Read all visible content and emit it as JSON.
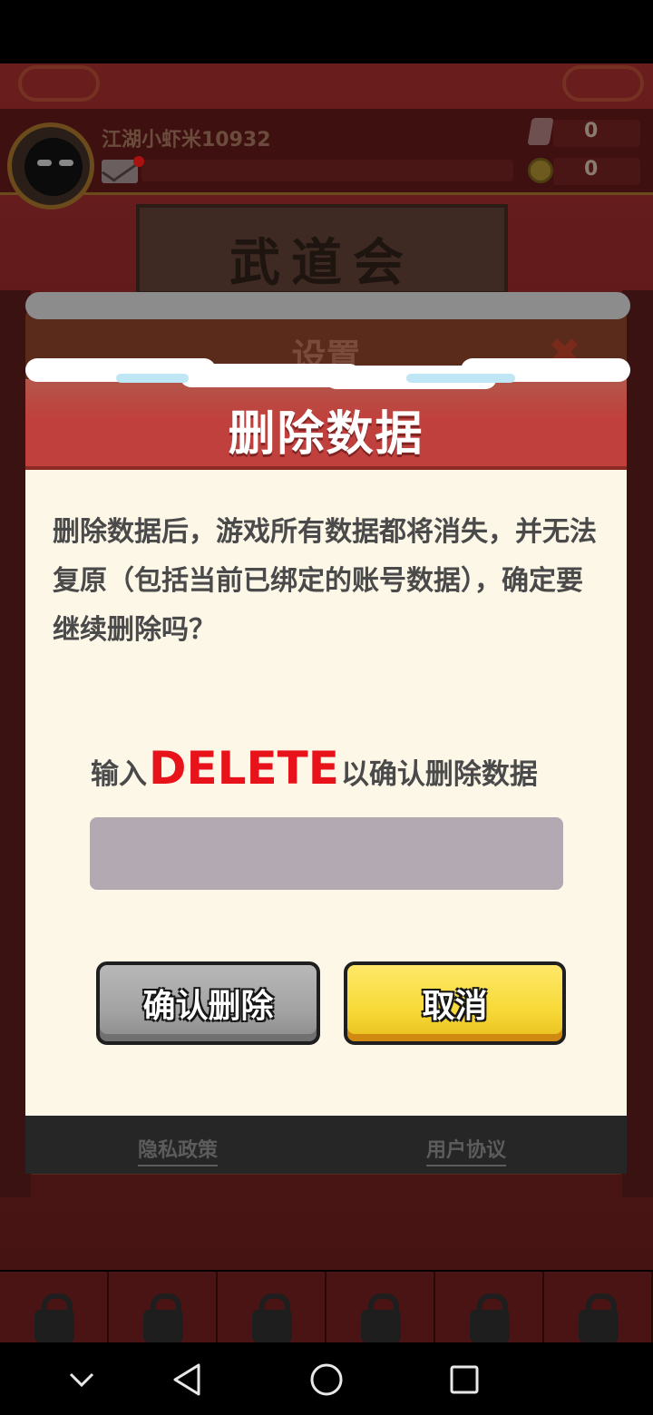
{
  "game": {
    "player_name": "江湖小虾米10932",
    "gems": "0",
    "coins": "0",
    "building_title": "武道会"
  },
  "settings": {
    "title": "设置",
    "privacy_link": "隐私政策",
    "terms_link": "用户协议"
  },
  "dialog": {
    "title": "删除数据",
    "message": "删除数据后，游戏所有数据都将消失，并无法复原（包括当前已绑定的账号数据），确定要继续删除吗？",
    "confirm_prefix": "输入",
    "confirm_keyword": "DELETE",
    "confirm_suffix": "以确认删除数据",
    "input_value": "",
    "confirm_button": "确认删除",
    "cancel_button": "取消"
  },
  "colors": {
    "header_red": "#c0403d",
    "dialog_bg": "#fdf7e8",
    "keyword_red": "#e8121a",
    "cancel_yellow": "#f7d937",
    "confirm_gray": "#a3a3a3"
  },
  "nav": {
    "icons": [
      "chevron-down-icon",
      "back-icon",
      "home-icon",
      "recent-apps-icon"
    ]
  }
}
